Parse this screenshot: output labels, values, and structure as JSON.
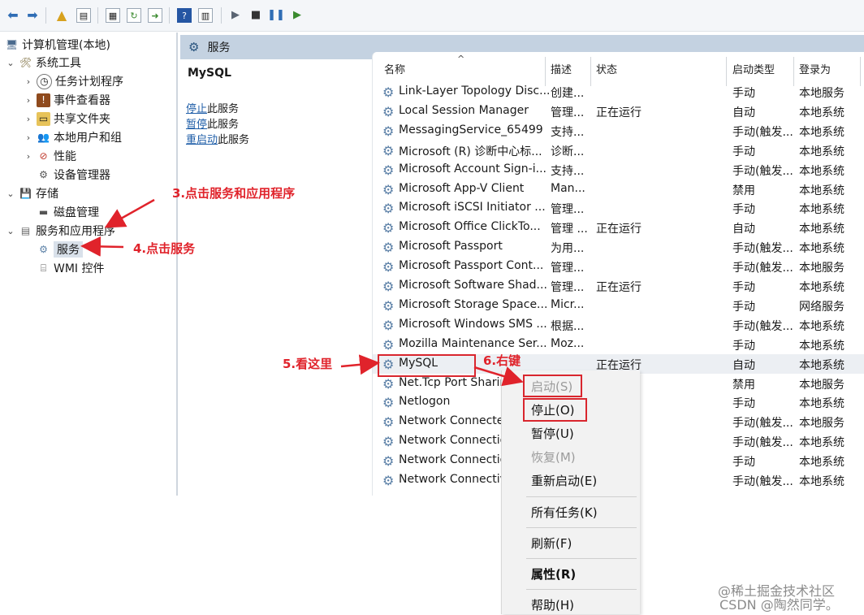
{
  "colors": {
    "accent": "#c4d2e1",
    "annotation": "#e0232b",
    "link": "#1f5ea8",
    "selection": "#d9e1ea"
  },
  "toolbar": {
    "icons": [
      "back-arrow-icon",
      "forward-arrow-icon",
      "up-folder-icon",
      "show-tree-icon",
      "properties-icon",
      "refresh-icon",
      "export-icon",
      "help-icon",
      "view-icon",
      "start-icon",
      "stop-icon",
      "pause-icon",
      "resume-icon"
    ]
  },
  "tree": {
    "root": "计算机管理(本地)",
    "system_tools": "系统工具",
    "task_scheduler": "任务计划程序",
    "event_viewer": "事件查看器",
    "shared_folders": "共享文件夹",
    "local_users": "本地用户和组",
    "performance": "性能",
    "device_manager": "设备管理器",
    "storage": "存储",
    "disk_management": "磁盘管理",
    "services_apps": "服务和应用程序",
    "services": "服务",
    "wmi": "WMI 控件"
  },
  "panel": {
    "title": "服务"
  },
  "details": {
    "service_name": "MySQL",
    "actions": [
      {
        "link": "停止",
        "suffix": "此服务"
      },
      {
        "link": "暂停",
        "suffix": "此服务"
      },
      {
        "link": "重启动",
        "suffix": "此服务"
      }
    ]
  },
  "columns": {
    "name": "名称",
    "desc": "描述",
    "state": "状态",
    "startup": "启动类型",
    "logon": "登录为"
  },
  "services": [
    {
      "name": "Link-Layer Topology Disc...",
      "desc": "创建...",
      "state": "",
      "startup": "手动",
      "logon": "本地服务"
    },
    {
      "name": "Local Session Manager",
      "desc": "管理...",
      "state": "正在运行",
      "startup": "自动",
      "logon": "本地系统"
    },
    {
      "name": "MessagingService_65499",
      "desc": "支持...",
      "state": "",
      "startup": "手动(触发...",
      "logon": "本地系统"
    },
    {
      "name": "Microsoft (R) 诊断中心标...",
      "desc": "诊断...",
      "state": "",
      "startup": "手动",
      "logon": "本地系统"
    },
    {
      "name": "Microsoft Account Sign-i...",
      "desc": "支持...",
      "state": "",
      "startup": "手动(触发...",
      "logon": "本地系统"
    },
    {
      "name": "Microsoft App-V Client",
      "desc": "Man...",
      "state": "",
      "startup": "禁用",
      "logon": "本地系统"
    },
    {
      "name": "Microsoft iSCSI Initiator ...",
      "desc": "管理...",
      "state": "",
      "startup": "手动",
      "logon": "本地系统"
    },
    {
      "name": "Microsoft Office ClickTo...",
      "desc": "管理 ...",
      "state": "正在运行",
      "startup": "自动",
      "logon": "本地系统"
    },
    {
      "name": "Microsoft Passport",
      "desc": "为用...",
      "state": "",
      "startup": "手动(触发...",
      "logon": "本地系统"
    },
    {
      "name": "Microsoft Passport Cont...",
      "desc": "管理...",
      "state": "",
      "startup": "手动(触发...",
      "logon": "本地服务"
    },
    {
      "name": "Microsoft Software Shad...",
      "desc": "管理...",
      "state": "正在运行",
      "startup": "手动",
      "logon": "本地系统"
    },
    {
      "name": "Microsoft Storage Space...",
      "desc": "Micr...",
      "state": "",
      "startup": "手动",
      "logon": "网络服务"
    },
    {
      "name": "Microsoft Windows SMS ...",
      "desc": "根据...",
      "state": "",
      "startup": "手动(触发...",
      "logon": "本地系统"
    },
    {
      "name": "Mozilla Maintenance Ser...",
      "desc": "Moz...",
      "state": "",
      "startup": "手动",
      "logon": "本地系统"
    },
    {
      "name": "MySQL",
      "desc": "",
      "state": "正在运行",
      "startup": "自动",
      "logon": "本地系统"
    },
    {
      "name": "Net.Tcp Port Sharing",
      "desc": "",
      "state": "",
      "startup": "禁用",
      "logon": "本地服务"
    },
    {
      "name": "Netlogon",
      "desc": "",
      "state": "",
      "startup": "手动",
      "logon": "本地系统"
    },
    {
      "name": "Network Connected",
      "desc": "",
      "state": "",
      "startup": "手动(触发...",
      "logon": "本地服务"
    },
    {
      "name": "Network Connection",
      "desc": "",
      "state": "",
      "startup": "手动(触发...",
      "logon": "本地系统"
    },
    {
      "name": "Network Connection",
      "desc": "",
      "state": "",
      "startup": "手动",
      "logon": "本地系统"
    },
    {
      "name": "Network Connectivity",
      "desc": "",
      "state": "",
      "startup": "手动(触发...",
      "logon": "本地系统"
    }
  ],
  "context_menu": {
    "start": "启动(S)",
    "stop": "停止(O)",
    "pause": "暂停(U)",
    "resume": "恢复(M)",
    "restart": "重新启动(E)",
    "all_tasks": "所有任务(K)",
    "refresh": "刷新(F)",
    "properties": "属性(R)",
    "help": "帮助(H)"
  },
  "annotations": {
    "step3": "3.点击服务和应用程序",
    "step4": "4.点击服务",
    "step5": "5.看这里",
    "step6": "6.右键"
  },
  "watermark": {
    "line1": "@稀土掘金技术社区",
    "line2": "CSDN @陶然同学。"
  }
}
